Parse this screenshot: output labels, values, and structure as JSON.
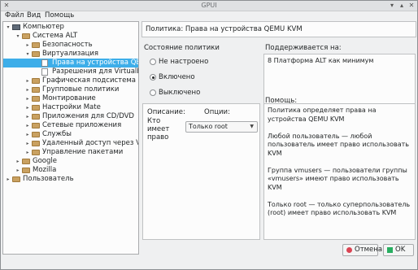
{
  "window": {
    "title": "GPUI"
  },
  "menubar": [
    {
      "label": "Файл"
    },
    {
      "label": "Вид"
    },
    {
      "label": "Помощь"
    }
  ],
  "tree": [
    {
      "label": "Компьютер",
      "icon": "computer-icon",
      "arrow": "▾"
    },
    {
      "label": "Система ALT",
      "icon": "folder-icon",
      "arrow": "▾"
    },
    {
      "label": "Безопасность",
      "icon": "folder-icon",
      "arrow": "▸"
    },
    {
      "label": "Виртуализация",
      "icon": "folder-icon",
      "arrow": "▾"
    },
    {
      "label": "Права на устройства QEMU KVM",
      "icon": "document-icon",
      "arrow": "",
      "selected": true
    },
    {
      "label": "Разрешения для VirtualBox",
      "icon": "document-icon",
      "arrow": ""
    },
    {
      "label": "Графическая подсистема",
      "icon": "folder-icon",
      "arrow": "▸"
    },
    {
      "label": "Групповые политики",
      "icon": "folder-icon",
      "arrow": "▸"
    },
    {
      "label": "Монтирование",
      "icon": "folder-icon",
      "arrow": "▸"
    },
    {
      "label": "Настройки Mate",
      "icon": "folder-icon",
      "arrow": "▸"
    },
    {
      "label": "Приложения для CD/DVD",
      "icon": "folder-icon",
      "arrow": "▸"
    },
    {
      "label": "Сетевые приложения",
      "icon": "folder-icon",
      "arrow": "▸"
    },
    {
      "label": "Службы",
      "icon": "folder-icon",
      "arrow": "▸"
    },
    {
      "label": "Удаленный доступ через Vino",
      "icon": "folder-icon",
      "arrow": "▸"
    },
    {
      "label": "Управление пакетами",
      "icon": "folder-icon",
      "arrow": "▸"
    },
    {
      "label": "Google",
      "icon": "folder-icon",
      "arrow": "▸"
    },
    {
      "label": "Mozilla",
      "icon": "folder-icon",
      "arrow": "▸"
    },
    {
      "label": "Пользователь",
      "icon": "folder-icon",
      "arrow": "▸"
    }
  ],
  "policy": {
    "header": "Политика: Права на устройства QEMU KVM",
    "state_label": "Состояние политики",
    "states": [
      {
        "label": "Не настроено",
        "checked": false
      },
      {
        "label": "Включено",
        "checked": true
      },
      {
        "label": "Выключено",
        "checked": false
      }
    ],
    "supported_label": "Поддерживается на:",
    "supported_value": "8 Платформа ALT как минимум",
    "description_label": "Описание:",
    "options_label": "Опции:",
    "option_name": "Кто имеет право",
    "option_value": "Только root",
    "help_label": "Помощь:",
    "help_lines": [
      "Политика определяет права на устройства QEMU KVM",
      "",
      "Любой пользователь — любой пользователь имеет право использовать KVM",
      "",
      "Группа vmusers — пользователи группы «vmusers» имеют право использовать KVM",
      "",
      "Только root — только суперпользователь (root) имеет право использовать KVM"
    ]
  },
  "buttons": {
    "cancel": "Отмена",
    "ok": "OK"
  }
}
